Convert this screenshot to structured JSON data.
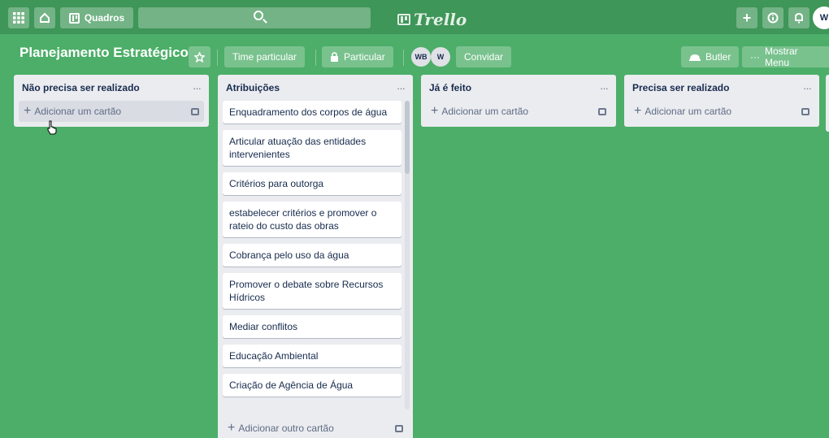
{
  "topbar": {
    "boards_label": "Quadros",
    "logo_text": "Trello",
    "user_initial": "W"
  },
  "board": {
    "title": "Planejamento Estratégico",
    "team_label": "Time particular",
    "visibility_label": "Particular",
    "members": [
      "WB",
      "W"
    ],
    "invite_label": "Convidar",
    "butler_label": "Butler",
    "menu_label": "Mostrar Menu"
  },
  "lists": [
    {
      "name": "Não precisa ser realizado",
      "cards": [],
      "add_label": "Adicionar um cartão"
    },
    {
      "name": "Atribuições",
      "cards": [
        "Enquadramento dos corpos de água",
        "Articular atuação das entidades intervenientes",
        "Critérios para outorga",
        "estabelecer critérios e promover o rateio do custo das obras",
        "Cobrança pelo uso da água",
        "Promover o debate sobre Recursos Hídricos",
        "Mediar conflitos",
        "Educação Ambiental",
        "Criação de Agência de Água"
      ],
      "add_label": "Adicionar outro cartão"
    },
    {
      "name": "Já é feito",
      "cards": [],
      "add_label": "Adicionar um cartão"
    },
    {
      "name": "Precisa ser realizado",
      "cards": [],
      "add_label": "Adicionar um cartão"
    }
  ],
  "colors": {
    "board_bg": "#4cae68",
    "nav_bg": "#3e9658",
    "list_bg": "#ebecf0"
  }
}
